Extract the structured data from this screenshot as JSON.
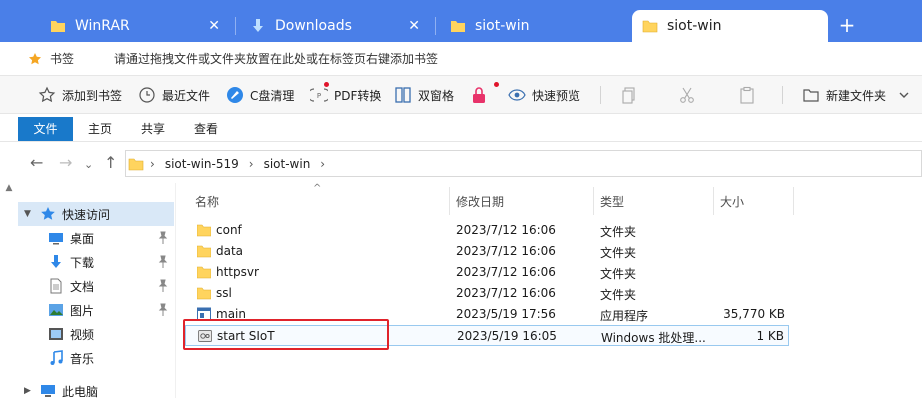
{
  "tabs": [
    {
      "label": "WinRAR",
      "icon": "folder-icon",
      "active": false
    },
    {
      "label": "Downloads",
      "icon": "download-icon",
      "active": false
    },
    {
      "label": "siot-win",
      "icon": "folder-icon",
      "active": false
    },
    {
      "label": "siot-win",
      "icon": "folder-icon",
      "active": true
    }
  ],
  "tab_close": "✕",
  "new_tab": "+",
  "bookmarks": {
    "title": "书签",
    "hint": "请通过拖拽文件或文件夹放置在此处或在标签页右键添加书签"
  },
  "toolbar": {
    "add_bookmark": "添加到书签",
    "recent_files": "最近文件",
    "c_clean": "C盘清理",
    "pdf_convert": "PDF转换",
    "dual_pane": "双窗格",
    "quick_preview": "快速预览",
    "new_folder": "新建文件夹"
  },
  "ribbon": {
    "file": "文件",
    "home": "主页",
    "share": "共享",
    "view": "查看"
  },
  "address": {
    "crumbs": [
      "siot-win-519",
      "siot-win"
    ],
    "separator": "›"
  },
  "nav_pane": {
    "quick_access": "快速访问",
    "items": [
      {
        "label": "桌面",
        "icon": "desktop-icon",
        "pinned": true
      },
      {
        "label": "下载",
        "icon": "download-icon",
        "pinned": true
      },
      {
        "label": "文档",
        "icon": "document-icon",
        "pinned": true
      },
      {
        "label": "图片",
        "icon": "pictures-icon",
        "pinned": true
      },
      {
        "label": "视频",
        "icon": "video-icon",
        "pinned": false
      },
      {
        "label": "音乐",
        "icon": "music-icon",
        "pinned": false
      }
    ],
    "this_pc": "此电脑"
  },
  "columns": {
    "name": "名称",
    "modified": "修改日期",
    "type": "类型",
    "size": "大小"
  },
  "files": [
    {
      "name": "conf",
      "modified": "2023/7/12 16:06",
      "type": "文件夹",
      "size": "",
      "icon": "folder-icon"
    },
    {
      "name": "data",
      "modified": "2023/7/12 16:06",
      "type": "文件夹",
      "size": "",
      "icon": "folder-icon"
    },
    {
      "name": "httpsvr",
      "modified": "2023/7/12 16:06",
      "type": "文件夹",
      "size": "",
      "icon": "folder-icon"
    },
    {
      "name": "ssl",
      "modified": "2023/7/12 16:06",
      "type": "文件夹",
      "size": "",
      "icon": "folder-icon"
    },
    {
      "name": "main",
      "modified": "2023/5/19 17:56",
      "type": "应用程序",
      "size": "35,770 KB",
      "icon": "application-icon"
    },
    {
      "name": "start SIoT",
      "modified": "2023/5/19 16:05",
      "type": "Windows 批处理...",
      "size": "1 KB",
      "icon": "batch-file-icon"
    }
  ],
  "colors": {
    "tabstrip": "#4a7fe8",
    "ribbon_active": "#1979ca",
    "selection": "#d9e8f7",
    "highlight_box": "#e0232b"
  }
}
